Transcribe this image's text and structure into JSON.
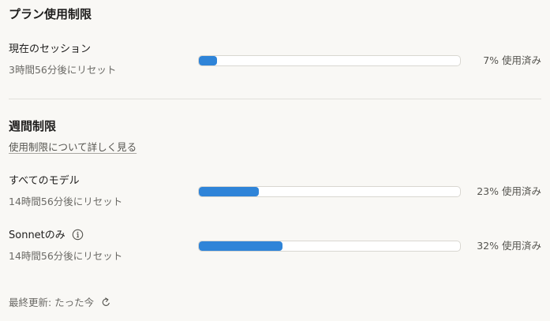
{
  "plan_section": {
    "title": "プラン使用制限",
    "current_session": {
      "label": "現在のセッション",
      "reset": "3時間56分後にリセット",
      "fill_fraction": 0.07,
      "usage_text": "7% 使用済み"
    }
  },
  "weekly_section": {
    "title": "週間制限",
    "learn_more": "使用制限について詳しく見る",
    "rows": [
      {
        "label": "すべてのモデル",
        "reset": "14時間56分後にリセット",
        "fill_fraction": 0.23,
        "usage_text": "23% 使用済み"
      },
      {
        "label": "Sonnetのみ",
        "reset": "14時間56分後にリセット",
        "fill_fraction": 0.32,
        "usage_text": "32% 使用済み",
        "icon": "info-icon"
      }
    ]
  },
  "footer": {
    "last_updated": "最終更新: たった今",
    "icon": "refresh-icon"
  },
  "colors": {
    "background": "#f9f8f5",
    "bar_fill": "#2f84d8",
    "bar_track": "#ffffff",
    "bar_border": "#d9d7d1"
  }
}
